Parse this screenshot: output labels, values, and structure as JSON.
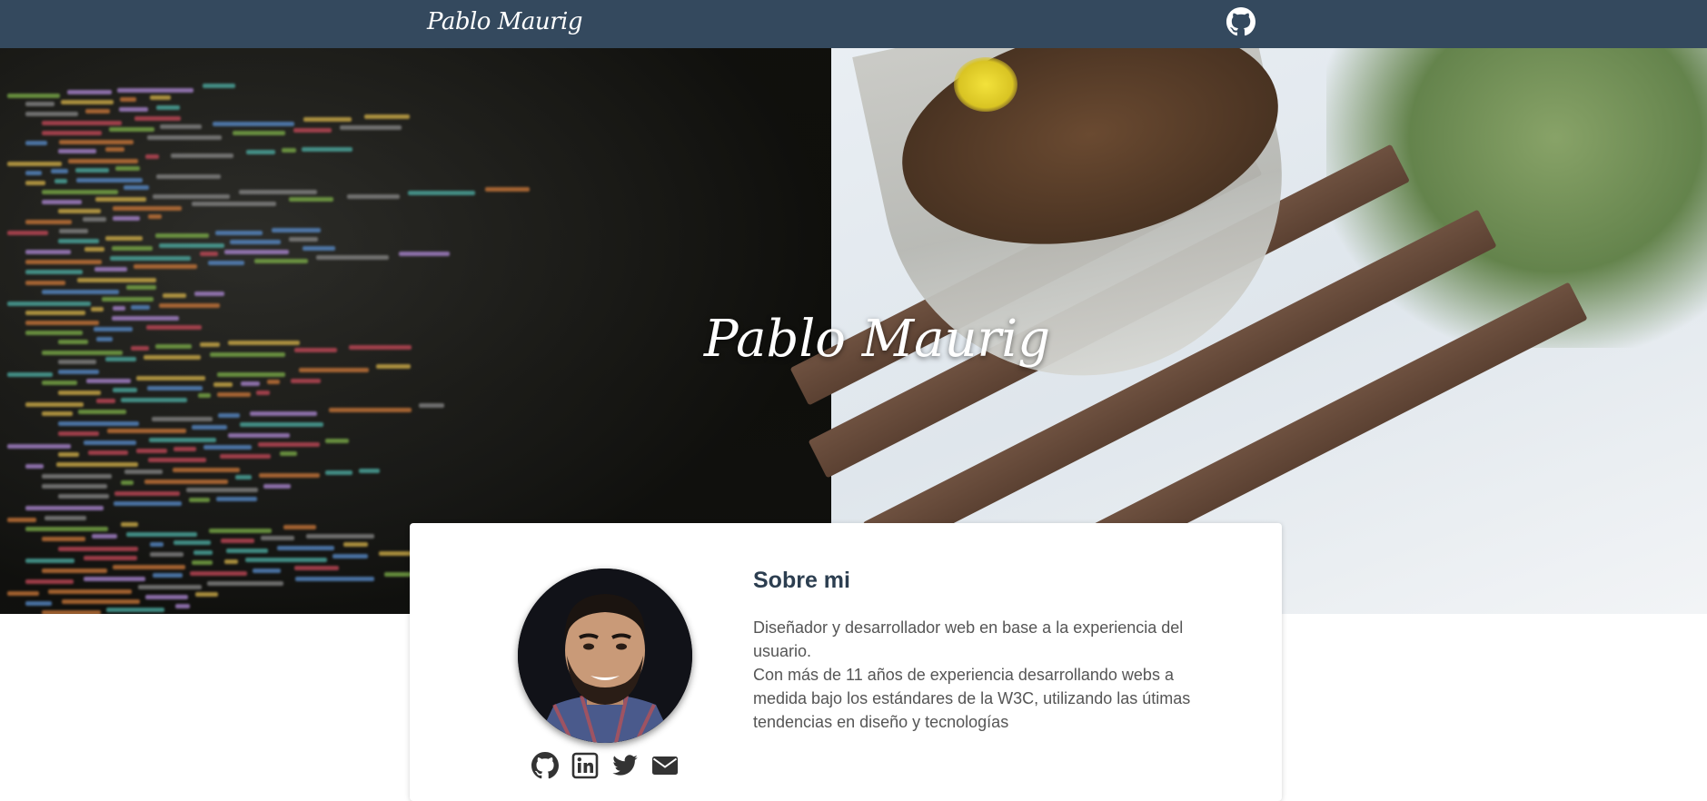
{
  "nav": {
    "brand": "Pablo Maurig",
    "github_icon": "github-icon"
  },
  "hero": {
    "title": "Pablo Maurig"
  },
  "about": {
    "title": "Sobre mi",
    "paragraph_1": "Diseñador y desarrollador web en base a la experiencia del usuario.",
    "paragraph_2": "Con más de 11 años de experiencia desarrollando webs a medida bajo los estándares de la W3C, utilizando las útimas tendencias en diseño y tecnologías"
  },
  "social": {
    "icons": [
      "github-icon",
      "linkedin-icon",
      "twitter-icon",
      "mail-icon"
    ]
  },
  "colors": {
    "nav_bg": "#34495e",
    "heading": "#2c3e50",
    "body_text": "#555555",
    "icon": "#333333"
  }
}
